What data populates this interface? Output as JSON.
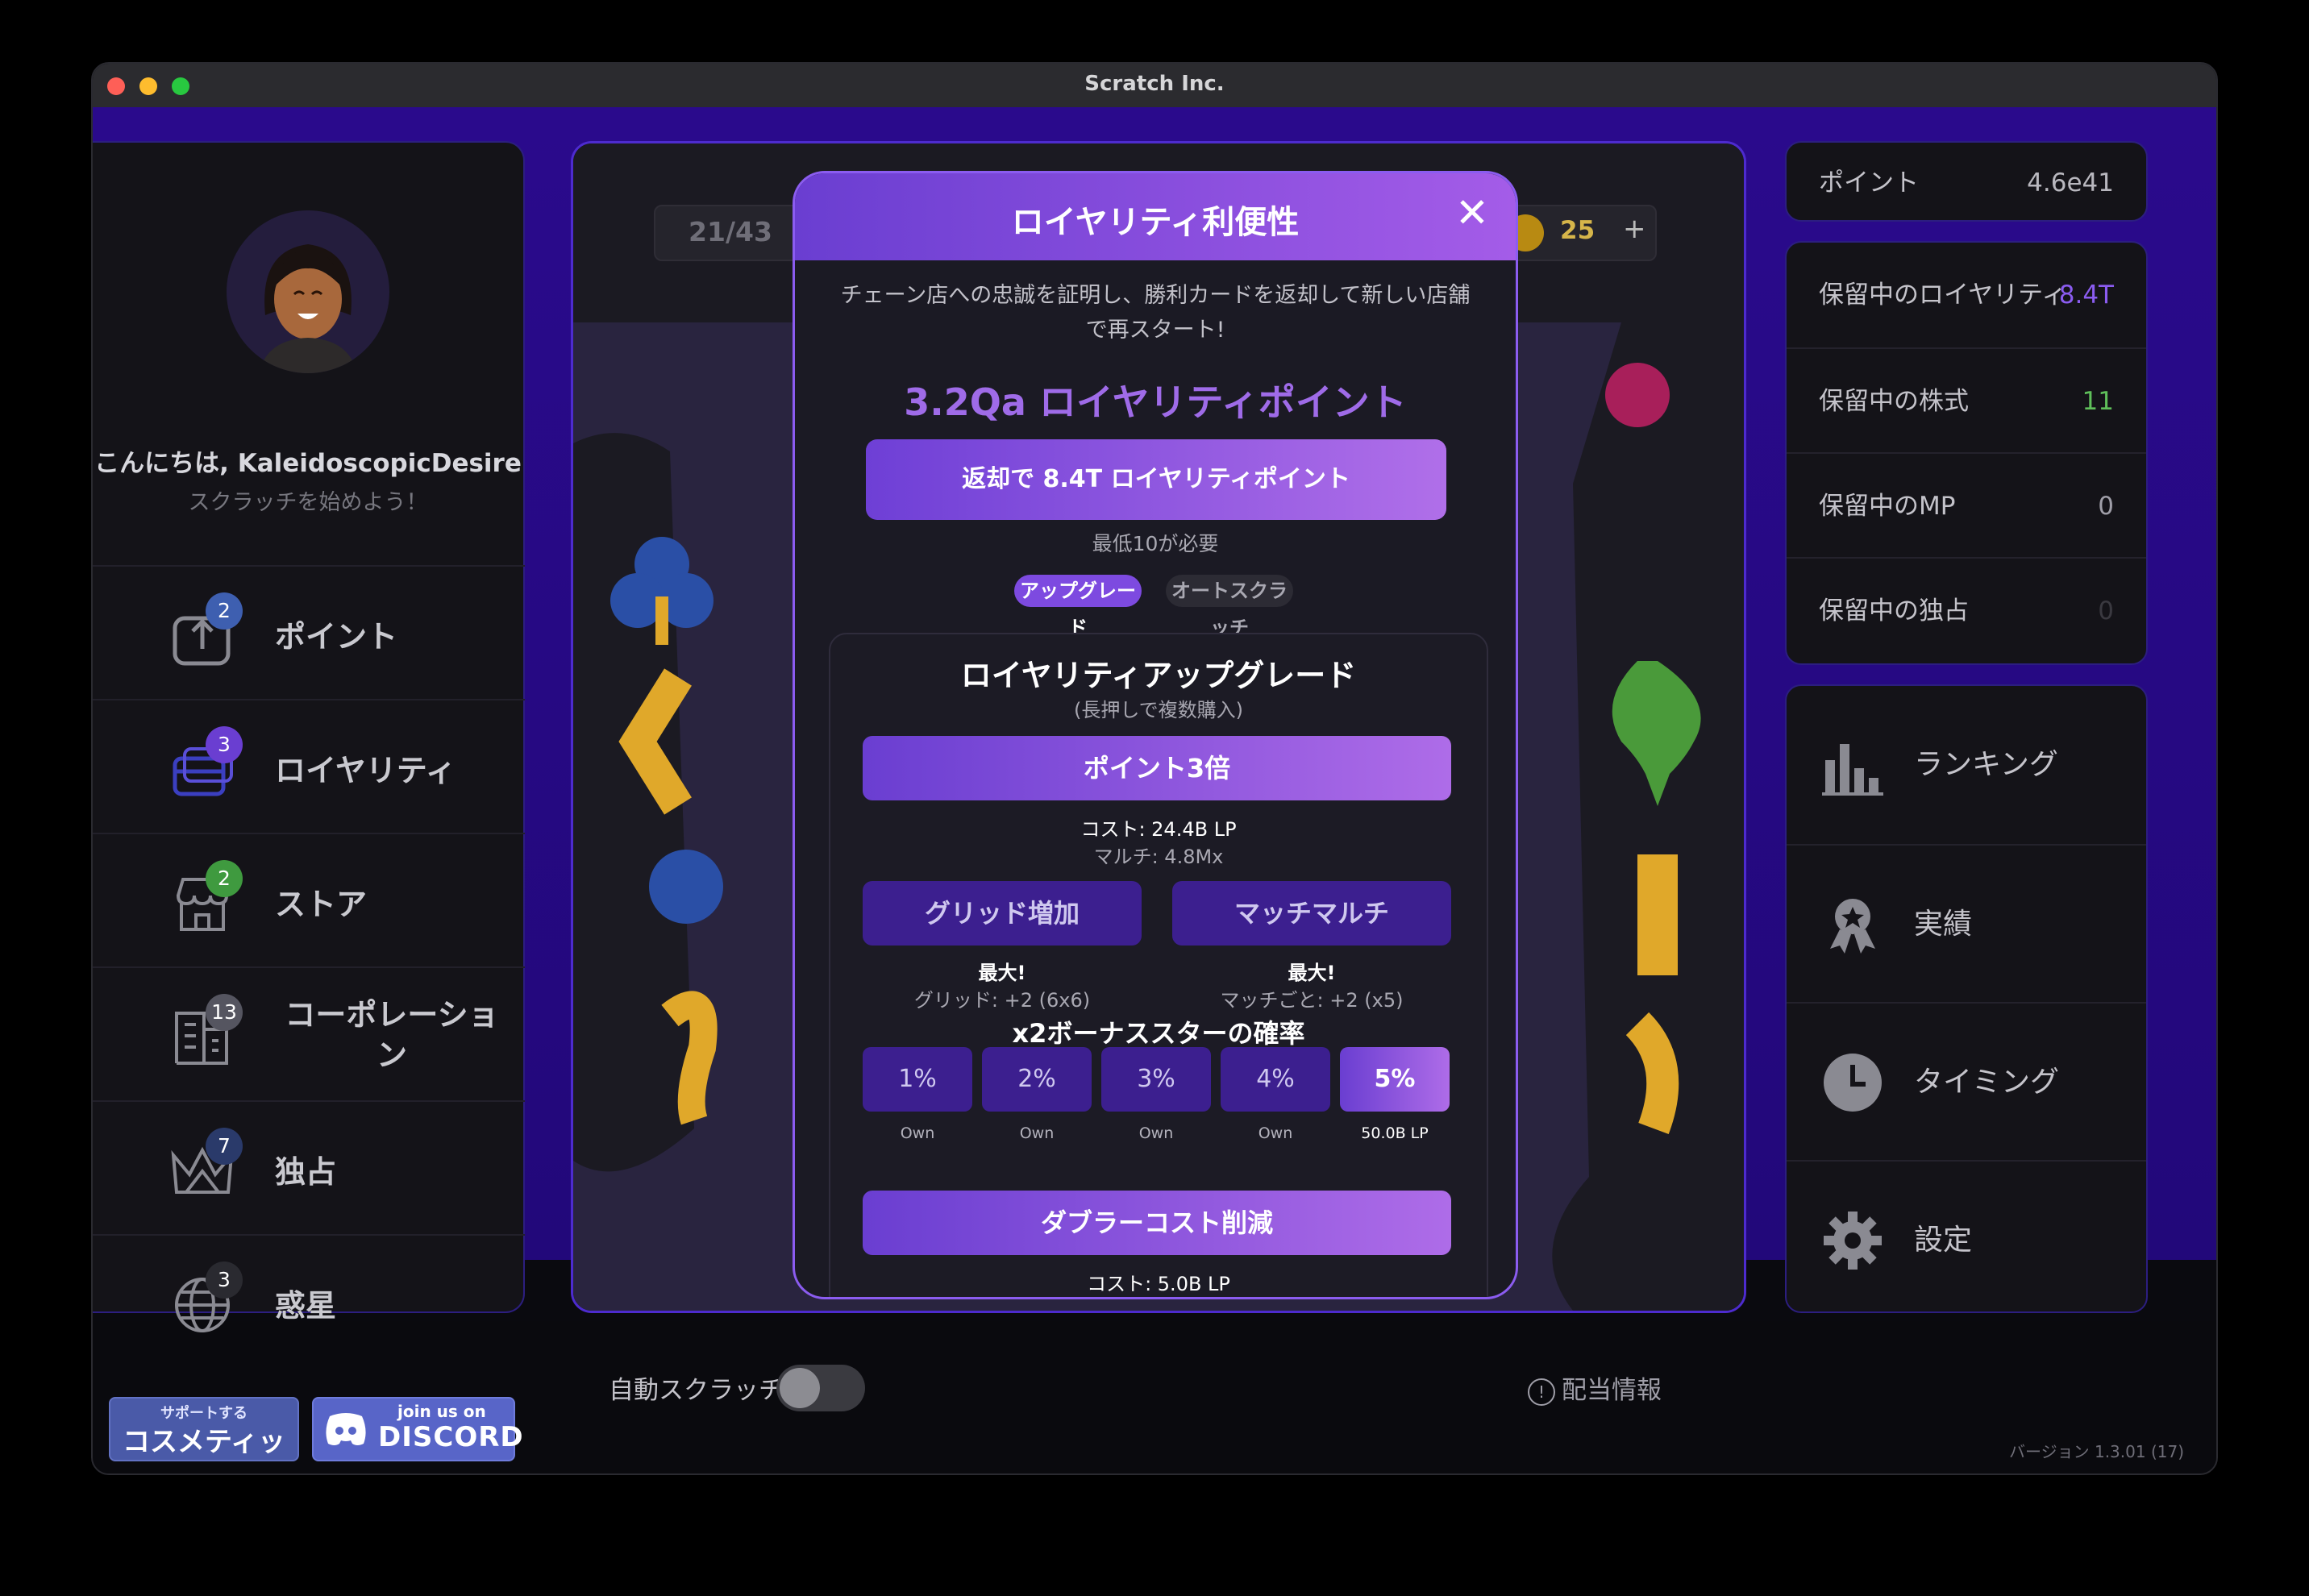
{
  "window": {
    "title": "Scratch Inc."
  },
  "sidebar": {
    "greeting": "こんにちは, KaleidoscopicDesire",
    "subtitle": "スクラッチを始めよう！",
    "items": [
      {
        "label": "ポイント",
        "badge": "2",
        "icon": "upload-icon"
      },
      {
        "label": "ロイヤリティ",
        "badge": "3",
        "icon": "card-icon"
      },
      {
        "label": "ストア",
        "badge": "2",
        "icon": "store-icon"
      },
      {
        "label": "コーポレーション",
        "badge": "13",
        "icon": "building-icon"
      },
      {
        "label": "独占",
        "badge": "7",
        "icon": "crown-icon"
      },
      {
        "label": "惑星",
        "badge": "3",
        "icon": "globe-icon"
      }
    ]
  },
  "main": {
    "page": "21/43",
    "coins": "25",
    "coins_plus": "+"
  },
  "modal": {
    "title": "ロイヤリティ利便性",
    "close": "✕",
    "description": "チェーン店への忠誠を証明し、勝利カードを返却して新しい店舗で再スタート!",
    "points": "3.2Qa ロイヤリティポイント",
    "return_button": "返却で 8.4T ロイヤリティポイント",
    "min_required": "最低10が必要",
    "tabs": [
      {
        "label": "アップグレー",
        "sub": "ド"
      },
      {
        "label": "オートスクラ",
        "sub": "ッチ"
      }
    ],
    "upgrade": {
      "title": "ロイヤリティアップグレード",
      "subtitle": "(長押しで複数購入)",
      "triple_button": "ポイント3倍",
      "triple_cost": "コスト: 24.4B LP",
      "triple_multi": "マルチ: 4.8Mx",
      "grid_button": "グリッド増加",
      "grid_max": "最大!",
      "grid_detail": "グリッド: +2 (6x6)",
      "match_button": "マッチマルチ",
      "match_max": "最大!",
      "match_detail": "マッチごと: +2 (x5)",
      "bonus_title": "x2ボーナススターの確率",
      "bonus_options": [
        {
          "label": "1%",
          "sub": "Own"
        },
        {
          "label": "2%",
          "sub": "Own"
        },
        {
          "label": "3%",
          "sub": "Own"
        },
        {
          "label": "4%",
          "sub": "Own"
        },
        {
          "label": "5%",
          "sub": "50.0B LP"
        }
      ],
      "doubler_button": "ダブラーコスト削減",
      "doubler_cost": "コスト: 5.0B LP"
    }
  },
  "right": {
    "points_label": "ポイント",
    "points_value": "4.6e41",
    "pending": [
      {
        "label": "保留中のロイヤリティ",
        "value": "8.4T",
        "color": "#8b5cf0"
      },
      {
        "label": "保留中の株式",
        "value": "11",
        "color": "#5fbf5a"
      },
      {
        "label": "保留中のMP",
        "value": "0",
        "color": "#9f9ea8"
      },
      {
        "label": "保留中の独占",
        "value": "0",
        "color": "#3a3940"
      }
    ],
    "menu": [
      {
        "label": "ランキング",
        "icon": "bar-chart-icon"
      },
      {
        "label": "実績",
        "icon": "award-icon"
      },
      {
        "label": "タイミング",
        "icon": "clock-icon"
      },
      {
        "label": "設定",
        "icon": "gear-icon"
      }
    ]
  },
  "bottom": {
    "support_small": "サポートする",
    "support_big": "コスメティック",
    "discord_small": "join us on",
    "discord_big": "DISCORD",
    "auto_scratch": "自動スクラッチ",
    "dividend_info": "配当情報",
    "version": "バージョン 1.3.01 (17)"
  },
  "colors": {
    "accent": "#8b5cf0",
    "brand_bg": "#2a0a8c"
  }
}
